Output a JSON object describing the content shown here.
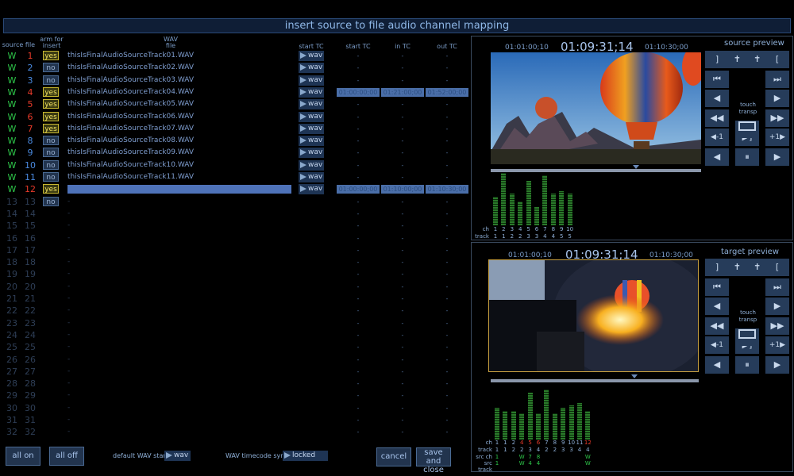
{
  "title": "insert source to file audio channel mapping",
  "columns": {
    "source": "source",
    "file": "file",
    "arm_for_insert": [
      "arm for",
      "insert"
    ],
    "wav_file": [
      "WAV",
      "file"
    ],
    "start_tc_btn": "start TC",
    "start_tc": "start TC",
    "in_tc": "in TC",
    "out_tc": "out TC"
  },
  "rows": [
    {
      "source": "W",
      "file": "1",
      "arm": "yes",
      "wav": "thisIsFinalAudioSourceTrack01.WAV",
      "btn": "wav",
      "start": "-",
      "in": "-",
      "out": "-"
    },
    {
      "source": "W",
      "file": "2",
      "arm": "no",
      "wav": "thisIsFinalAudioSourceTrack02.WAV",
      "btn": "wav",
      "start": "-",
      "in": "-",
      "out": "-"
    },
    {
      "source": "W",
      "file": "3",
      "arm": "no",
      "wav": "thisIsFinalAudioSourceTrack03.WAV",
      "btn": "wav",
      "start": "-",
      "in": "-",
      "out": "-"
    },
    {
      "source": "W",
      "file": "4",
      "arm": "yes",
      "wav": "thisIsFinalAudioSourceTrack04.WAV",
      "btn": "wav",
      "start": "01:00:00;00",
      "in": "01:21:00;00",
      "out": "01:52:00;00"
    },
    {
      "source": "W",
      "file": "5",
      "arm": "yes",
      "wav": "thisIsFinalAudioSourceTrack05.WAV",
      "btn": "wav",
      "start": "-",
      "in": "-",
      "out": "-"
    },
    {
      "source": "W",
      "file": "6",
      "arm": "yes",
      "wav": "thisIsFinalAudioSourceTrack06.WAV",
      "btn": "wav",
      "start": "-",
      "in": "-",
      "out": "-"
    },
    {
      "source": "W",
      "file": "7",
      "arm": "yes",
      "wav": "thisIsFinalAudioSourceTrack07.WAV",
      "btn": "wav",
      "start": "-",
      "in": "-",
      "out": "-"
    },
    {
      "source": "W",
      "file": "8",
      "arm": "no",
      "wav": "thisIsFinalAudioSourceTrack08.WAV",
      "btn": "wav",
      "start": "-",
      "in": "-",
      "out": "-"
    },
    {
      "source": "W",
      "file": "9",
      "arm": "no",
      "wav": "thisIsFinalAudioSourceTrack09.WAV",
      "btn": "wav",
      "start": "-",
      "in": "-",
      "out": "-"
    },
    {
      "source": "W",
      "file": "10",
      "arm": "no",
      "wav": "thisIsFinalAudioSourceTrack10.WAV",
      "btn": "wav",
      "start": "-",
      "in": "-",
      "out": "-"
    },
    {
      "source": "W",
      "file": "11",
      "arm": "no",
      "wav": "thisIsFinalAudioSourceTrack11.WAV",
      "btn": "wav",
      "start": "-",
      "in": "-",
      "out": "-"
    },
    {
      "source": "W",
      "file": "12",
      "arm": "yes",
      "wav": "",
      "btn": "wav",
      "start": "01:00:00;00",
      "in": "01:10:00;00",
      "out": "01:10:30;00"
    },
    {
      "source": "13",
      "file": "13",
      "arm": "no",
      "wav": "-",
      "btn": "",
      "start": "-",
      "in": "-",
      "out": "-"
    },
    {
      "source": "14",
      "file": "14",
      "arm": "",
      "wav": "-",
      "btn": "",
      "start": "-",
      "in": "-",
      "out": "-"
    },
    {
      "source": "15",
      "file": "15",
      "arm": "",
      "wav": "-",
      "btn": "",
      "start": "-",
      "in": "-",
      "out": "-"
    },
    {
      "source": "16",
      "file": "16",
      "arm": "",
      "wav": "-",
      "btn": "",
      "start": "-",
      "in": "-",
      "out": "-"
    },
    {
      "source": "17",
      "file": "17",
      "arm": "",
      "wav": "-",
      "btn": "",
      "start": "-",
      "in": "-",
      "out": "-"
    },
    {
      "source": "18",
      "file": "18",
      "arm": "",
      "wav": "-",
      "btn": "",
      "start": "-",
      "in": "-",
      "out": "-"
    },
    {
      "source": "19",
      "file": "19",
      "arm": "",
      "wav": "-",
      "btn": "",
      "start": "-",
      "in": "-",
      "out": "-"
    },
    {
      "source": "20",
      "file": "20",
      "arm": "",
      "wav": "-",
      "btn": "",
      "start": "-",
      "in": "-",
      "out": "-"
    },
    {
      "source": "21",
      "file": "21",
      "arm": "",
      "wav": "-",
      "btn": "",
      "start": "-",
      "in": "-",
      "out": "-"
    },
    {
      "source": "22",
      "file": "22",
      "arm": "",
      "wav": "-",
      "btn": "",
      "start": "-",
      "in": "-",
      "out": "-"
    },
    {
      "source": "23",
      "file": "23",
      "arm": "",
      "wav": "-",
      "btn": "",
      "start": "-",
      "in": "-",
      "out": "-"
    },
    {
      "source": "24",
      "file": "24",
      "arm": "",
      "wav": "-",
      "btn": "",
      "start": "-",
      "in": "-",
      "out": "-"
    },
    {
      "source": "25",
      "file": "25",
      "arm": "",
      "wav": "-",
      "btn": "",
      "start": "-",
      "in": "-",
      "out": "-"
    },
    {
      "source": "26",
      "file": "26",
      "arm": "",
      "wav": "-",
      "btn": "",
      "start": "-",
      "in": "-",
      "out": "-"
    },
    {
      "source": "27",
      "file": "27",
      "arm": "",
      "wav": "-",
      "btn": "",
      "start": "-",
      "in": "-",
      "out": "-"
    },
    {
      "source": "28",
      "file": "28",
      "arm": "",
      "wav": "-",
      "btn": "",
      "start": "-",
      "in": "-",
      "out": "-"
    },
    {
      "source": "29",
      "file": "29",
      "arm": "",
      "wav": "-",
      "btn": "",
      "start": "-",
      "in": "-",
      "out": "-"
    },
    {
      "source": "30",
      "file": "30",
      "arm": "",
      "wav": "-",
      "btn": "",
      "start": "-",
      "in": "-",
      "out": "-"
    },
    {
      "source": "31",
      "file": "31",
      "arm": "",
      "wav": "-",
      "btn": "",
      "start": "-",
      "in": "-",
      "out": "-"
    },
    {
      "source": "32",
      "file": "32",
      "arm": "",
      "wav": "-",
      "btn": "",
      "start": "-",
      "in": "-",
      "out": "-"
    }
  ],
  "colors": {
    "source_w": "#2ec84a",
    "file_armed": "#e83a2a",
    "file_default": "#4a8ae0",
    "inactive": "#2e3e56"
  },
  "source_preview": {
    "title": "source preview",
    "tc_left": "01:01:00;10",
    "tc_main": "01:09:31;14",
    "tc_right": "01:10:30;00",
    "touch_label": [
      "touch",
      "transp"
    ],
    "buttons": [
      "]",
      "✝",
      "✝",
      "[",
      "⏮",
      "⏭",
      "◀",
      "▶",
      "◀◀",
      "▶▶",
      "◀-1",
      "▶]",
      "+1▶",
      "◀",
      "⏸",
      "▶"
    ],
    "meter_levels": [
      0.55,
      1.0,
      0.6,
      0.45,
      0.85,
      0.35,
      0.95,
      0.6,
      0.65,
      0.6
    ],
    "ch_labels": [
      "1",
      "2",
      "3",
      "4",
      "5",
      "6",
      "7",
      "8",
      "9",
      "10"
    ],
    "track_labels": [
      "1",
      "1",
      "2",
      "2",
      "3",
      "3",
      "4",
      "4",
      "5",
      "5"
    ],
    "row_labels": {
      "ch": "ch",
      "track": "track"
    }
  },
  "target_preview": {
    "title": "target preview",
    "tc_left": "01:01:00;10",
    "tc_main": "01:09:31;14",
    "tc_right": "01:10:30;00",
    "touch_label": [
      "touch",
      "transp"
    ],
    "buttons": [
      "]",
      "✝",
      "✝",
      "[",
      "⏮",
      "⏭",
      "◀",
      "▶",
      "◀◀",
      "▶▶",
      "◀-1",
      "▶]",
      "+1▶",
      "◀",
      "⏸",
      "▶"
    ],
    "meter_levels": [
      0.6,
      0.55,
      0.55,
      0.5,
      0.9,
      0.5,
      0.95,
      0.5,
      0.6,
      0.65,
      0.7,
      0.55
    ],
    "ch_labels": [
      "1",
      "1",
      "2",
      "4",
      "5",
      "6",
      "7",
      "8",
      "9",
      "10",
      "11",
      "12"
    ],
    "track_labels": [
      "1",
      "1",
      "2",
      "2",
      "3",
      "4",
      "2",
      "2",
      "3",
      "3",
      "4",
      "4"
    ],
    "src_ch_labels": [
      "1",
      "",
      "",
      "W",
      "7",
      "8",
      "",
      "",
      "",
      "",
      "",
      "W"
    ],
    "src_track_labels": [
      "1",
      "",
      "",
      "W",
      "4",
      "4",
      "",
      "",
      "",
      "",
      "",
      "W"
    ],
    "row_labels": {
      "ch": "ch",
      "track": "track",
      "src_ch": "src ch",
      "src_track": "src track"
    }
  },
  "footer": {
    "all_on": "all on",
    "all_off": "all off",
    "default_wav_start_label": "default WAV start",
    "default_wav_start_value": "wav",
    "wav_tc_sync_label": "WAV timecode sync",
    "wav_tc_sync_value": "locked",
    "cancel": "cancel",
    "save_and_close": [
      "save and",
      "close"
    ]
  }
}
